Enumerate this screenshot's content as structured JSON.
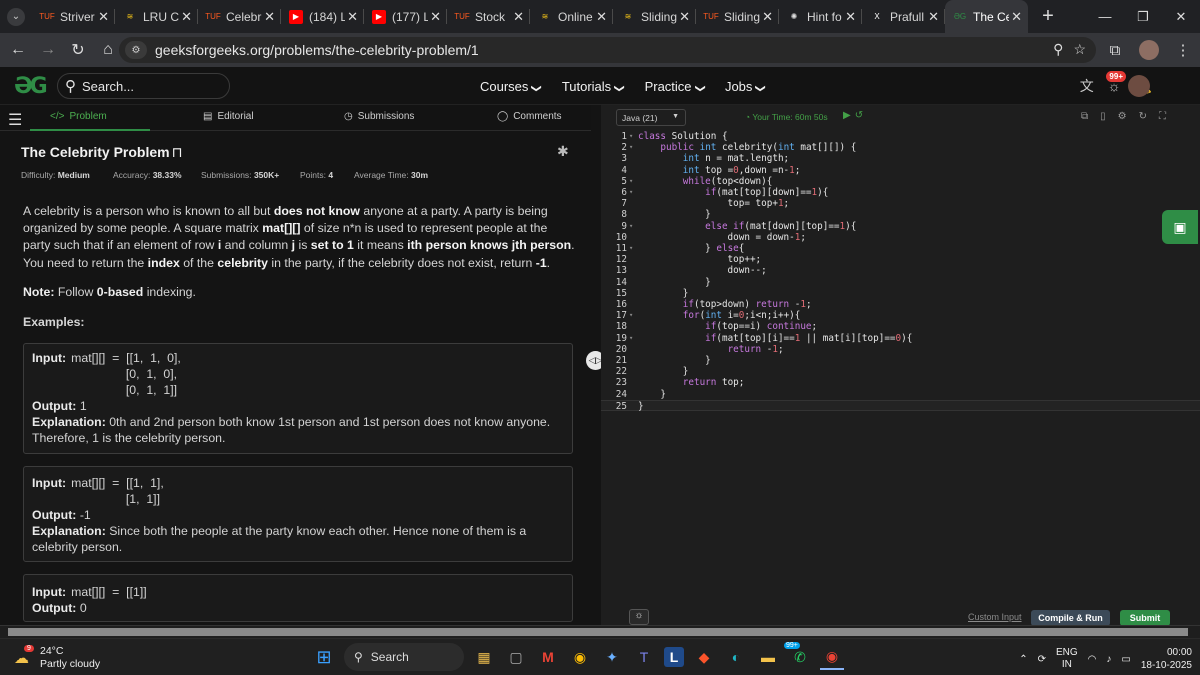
{
  "browser": {
    "tabs": [
      {
        "label": "Striver",
        "icon": "tuf-icon",
        "color": "#ff5a1f",
        "active": false
      },
      {
        "label": "LRU C",
        "icon": "codeforces-icon",
        "color": "#f5c518",
        "active": false
      },
      {
        "label": "Celebr",
        "icon": "tuf-icon",
        "color": "#ff5a1f",
        "active": false
      },
      {
        "label": "(184) L",
        "icon": "youtube-icon",
        "color": "#ff0000",
        "active": false
      },
      {
        "label": "(177) L",
        "icon": "youtube-icon",
        "color": "#ff0000",
        "active": false
      },
      {
        "label": "Stock",
        "icon": "tuf-icon",
        "color": "#ff5a1f",
        "active": false
      },
      {
        "label": "Online",
        "icon": "codeforces-icon",
        "color": "#f5c518",
        "active": false
      },
      {
        "label": "Sliding",
        "icon": "codeforces-icon",
        "color": "#f5c518",
        "active": false
      },
      {
        "label": "Sliding",
        "icon": "tuf-icon",
        "color": "#ff5a1f",
        "active": false
      },
      {
        "label": "Hint fo",
        "icon": "openai-icon",
        "color": "#dddddd",
        "active": false
      },
      {
        "label": "Prafull",
        "icon": "x-icon",
        "color": "#ffffff",
        "active": false
      },
      {
        "label": "The Ce",
        "icon": "gfg-icon",
        "color": "#2f8d46",
        "active": true
      }
    ],
    "url": "geeksforgeeks.org/problems/the-celebrity-problem/1"
  },
  "gfg_header": {
    "logo": "ƏG",
    "search_placeholder": "Search...",
    "nav": [
      "Courses",
      "Tutorials",
      "Practice",
      "Jobs"
    ],
    "notification_count": "99+"
  },
  "left_tabs": [
    "Problem",
    "Editorial",
    "Submissions",
    "Comments"
  ],
  "problem": {
    "title": "The Celebrity Problem",
    "meta": {
      "difficulty_label": "Difficulty:",
      "difficulty": "Medium",
      "accuracy_label": "Accuracy:",
      "accuracy": "38.33%",
      "submissions_label": "Submissions:",
      "submissions": "350K+",
      "points_label": "Points:",
      "points": "4",
      "time_label": "Average Time:",
      "time": "30m"
    },
    "description": [
      {
        "t": "A celebrity is a person who is known to all but "
      },
      {
        "t": "does not know",
        "b": true
      },
      {
        "t": " anyone at a party. A party is being organized by some people. A square matrix "
      },
      {
        "t": "mat[][]",
        "b": true
      },
      {
        "t": " of size n*n is used to represent people at the party such that if an element of row "
      },
      {
        "t": "i",
        "b": true
      },
      {
        "t": " and column "
      },
      {
        "t": "j",
        "b": true
      },
      {
        "t": " is "
      },
      {
        "t": "set to 1",
        "b": true
      },
      {
        "t": " it means "
      },
      {
        "t": "ith person knows jth person",
        "b": true
      },
      {
        "t": ". You need to return the "
      },
      {
        "t": "index",
        "b": true
      },
      {
        "t": " of the "
      },
      {
        "t": "celebrity",
        "b": true
      },
      {
        "t": " in the party, if the celebrity does not exist, return "
      },
      {
        "t": "-1",
        "b": true
      },
      {
        "t": "."
      }
    ],
    "note_label": "Note:",
    "note_text": " Follow ",
    "note_bold": "0-based",
    "note_tail": " indexing.",
    "examples_label": "Examples:",
    "examples": [
      {
        "input_label": "Input:",
        "input": "mat[][]  =  [[1,  1,  0],\n                [0,  1,  0],\n                [0,  1,  1]]",
        "output_label": "Output:",
        "output": "1",
        "explanation_label": "Explanation:",
        "explanation": "0th and 2nd person both know 1st person and 1st person does not know anyone. Therefore, 1 is the celebrity person."
      },
      {
        "input_label": "Input:",
        "input": "mat[][]  =  [[1,  1],\n                [1,  1]]",
        "output_label": "Output:",
        "output": "-1",
        "explanation_label": "Explanation:",
        "explanation": "Since both the people at the party know each other. Hence none of them is a celebrity person."
      },
      {
        "input_label": "Input:",
        "input": "mat[][]  =  [[1]]",
        "output_label": "Output:",
        "output": "0"
      }
    ]
  },
  "editor": {
    "language": "Java (21)",
    "timer": "Your Time: 60m 50s",
    "code_lines": [
      "class Solution {",
      "    public int celebrity(int mat[][]) {",
      "        int n = mat.length;",
      "        int top =0,down =n-1;",
      "        while(top<down){",
      "            if(mat[top][down]==1){",
      "                top= top+1;",
      "            }",
      "            else if(mat[down][top]==1){",
      "                down = down-1;",
      "            } else{",
      "                top++;",
      "                down--;",
      "            }",
      "        }",
      "        if(top>down) return -1;",
      "        for(int i=0;i<n;i++){",
      "            if(top==i) continue;",
      "            if(mat[top][i]==1 || mat[i][top]==0){",
      "                return -1;",
      "            }",
      "        }",
      "        return top;",
      "    }",
      "}"
    ],
    "foldable_lines": [
      1,
      2,
      5,
      6,
      9,
      11,
      17,
      19
    ],
    "custom_input_label": "Custom Input",
    "compile_label": "Compile & Run",
    "submit_label": "Submit"
  },
  "taskbar": {
    "weather_temp": "24°C",
    "weather_desc": "Partly cloudy",
    "weather_badge": "9",
    "search_label": "Search",
    "whatsapp_badge": "99+",
    "lang_line1": "ENG",
    "lang_line2": "IN",
    "time": "00:00",
    "date": "18-10-2025"
  }
}
